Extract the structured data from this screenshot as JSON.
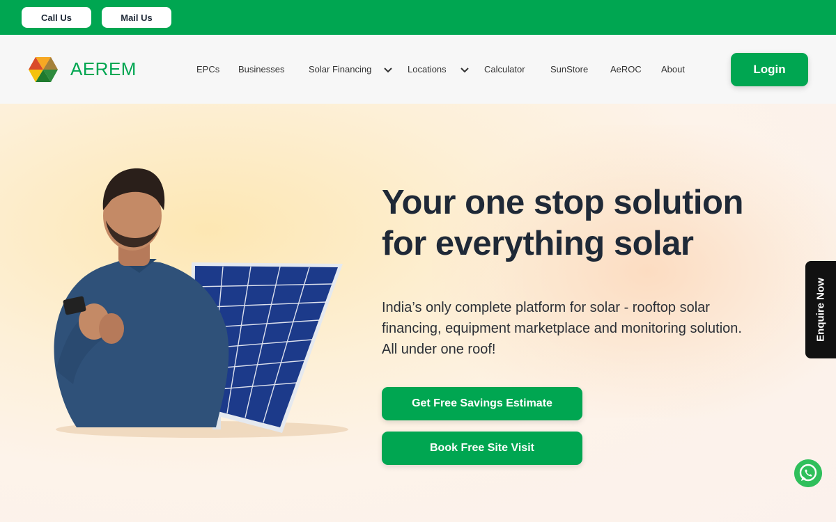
{
  "topbar": {
    "call_label": "Call Us",
    "mail_label": "Mail Us"
  },
  "brand": {
    "name": "AEREM",
    "color": "#00a651"
  },
  "nav": {
    "items": [
      {
        "label": "EPCs"
      },
      {
        "label": "Businesses"
      },
      {
        "label": "Solar Financing",
        "dropdown": true
      },
      {
        "label": "Locations",
        "dropdown": true
      },
      {
        "label": "Calculator"
      },
      {
        "label": "SunStore"
      },
      {
        "label": "AeROC"
      },
      {
        "label": "About"
      }
    ],
    "login_label": "Login"
  },
  "hero": {
    "headline_line1": "Your one stop solution",
    "headline_line2": "for everything solar",
    "subtext_line1": "India’s only complete platform for solar - rooftop solar",
    "subtext_line2": "financing, equipment marketplace and monitoring solution.",
    "subtext_line3": "All under one roof!",
    "cta_primary": "Get Free Savings Estimate",
    "cta_secondary": "Book Free Site Visit"
  },
  "side": {
    "enquire_label": "Enquire Now",
    "whatsapp_icon": "whatsapp-icon"
  },
  "colors": {
    "accent": "#00a651",
    "text_dark": "#1f2937"
  }
}
